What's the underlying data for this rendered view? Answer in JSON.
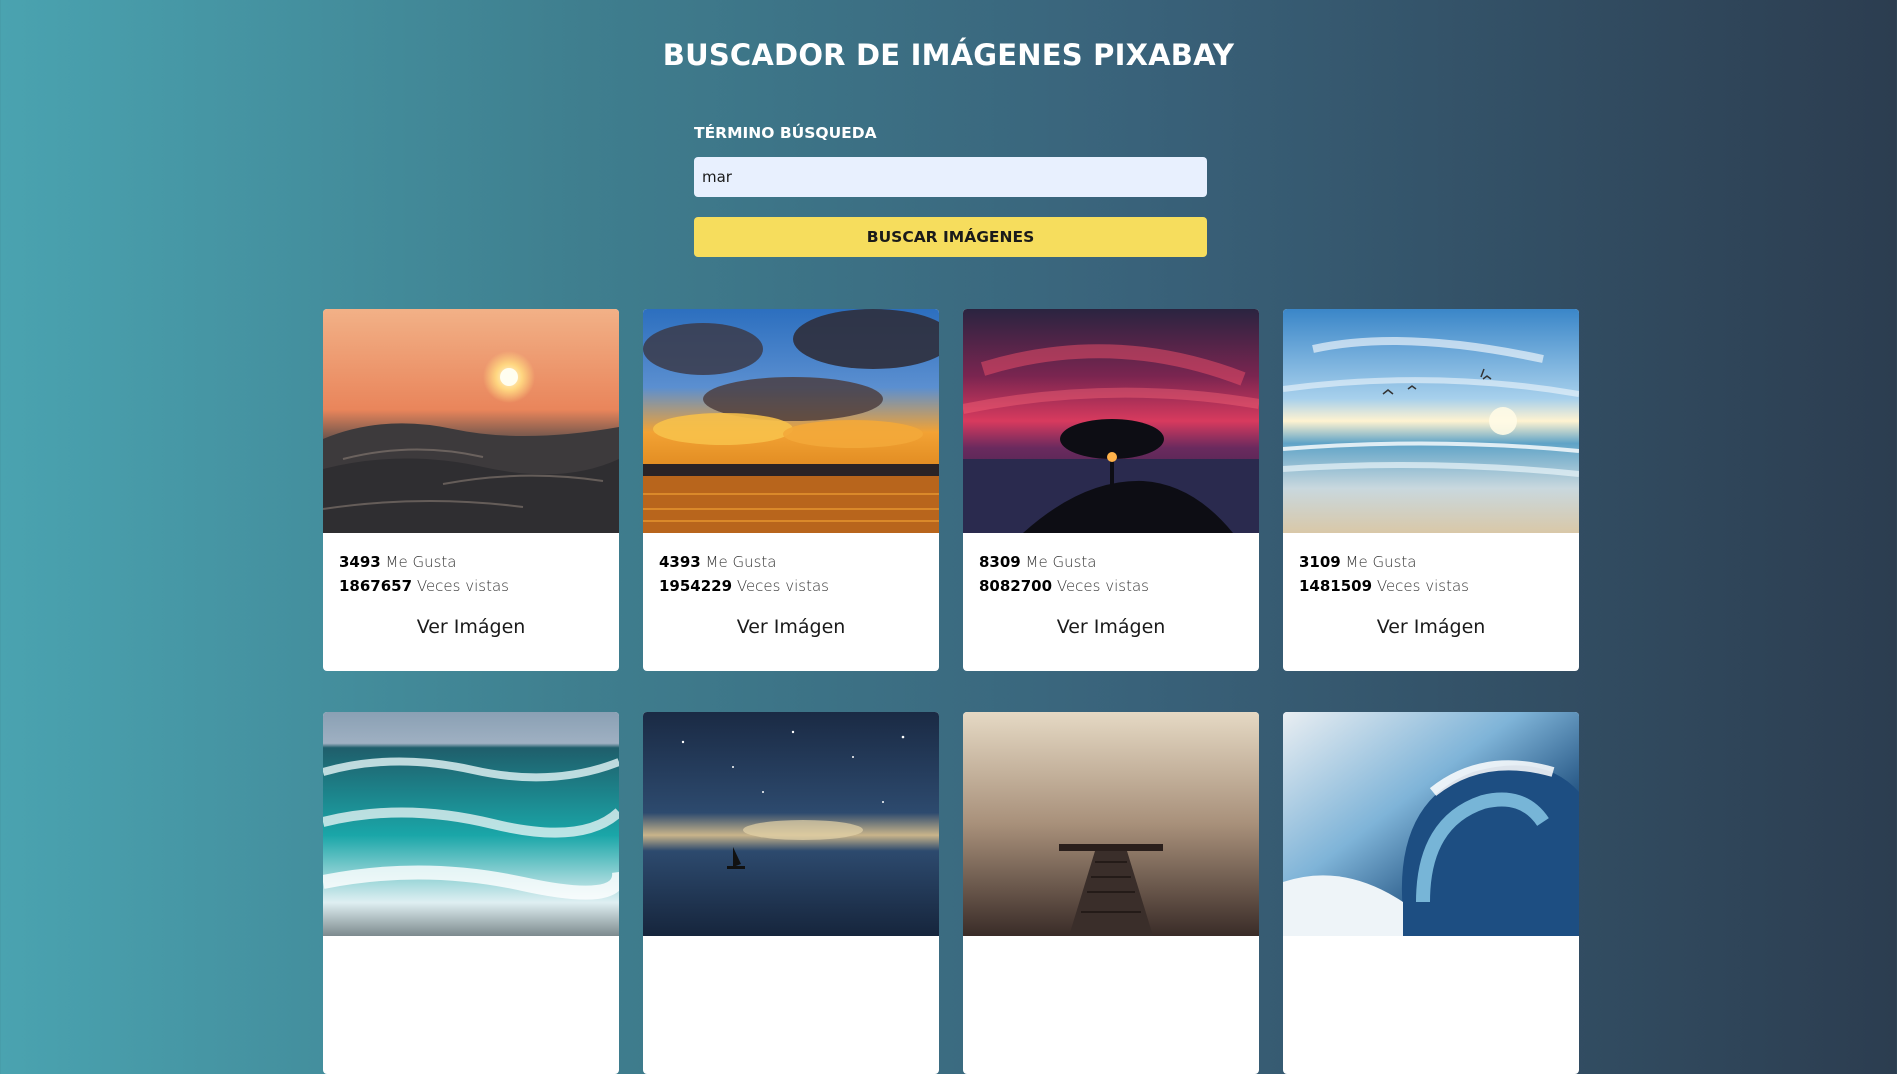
{
  "header": {
    "title": "BUSCADOR DE IMÁGENES PIXABAY"
  },
  "search": {
    "label": "TÉRMINO BÚSQUEDA",
    "value": "mar",
    "button_label": "BUSCAR IMÁGENES"
  },
  "results": [
    {
      "image": "ocean-wave-sunset",
      "likes": "3493",
      "likes_label": "Me Gusta",
      "views": "1867657",
      "views_label": "Veces vistas",
      "link_label": "Ver Imágen"
    },
    {
      "image": "sunset-clouds-over-sea",
      "likes": "4393",
      "likes_label": "Me Gusta",
      "views": "1954229",
      "views_label": "Veces vistas",
      "link_label": "Ver Imágen"
    },
    {
      "image": "tree-silhouette-red-sky",
      "likes": "8309",
      "likes_label": "Me Gusta",
      "views": "8082700",
      "views_label": "Veces vistas",
      "link_label": "Ver Imágen"
    },
    {
      "image": "beach-with-birds",
      "likes": "3109",
      "likes_label": "Me Gusta",
      "views": "1481509",
      "views_label": "Veces vistas",
      "link_label": "Ver Imágen"
    },
    {
      "image": "turquoise-waves"
    },
    {
      "image": "sailboat-starry-night"
    },
    {
      "image": "pier-in-fog"
    },
    {
      "image": "breaking-wave"
    }
  ]
}
